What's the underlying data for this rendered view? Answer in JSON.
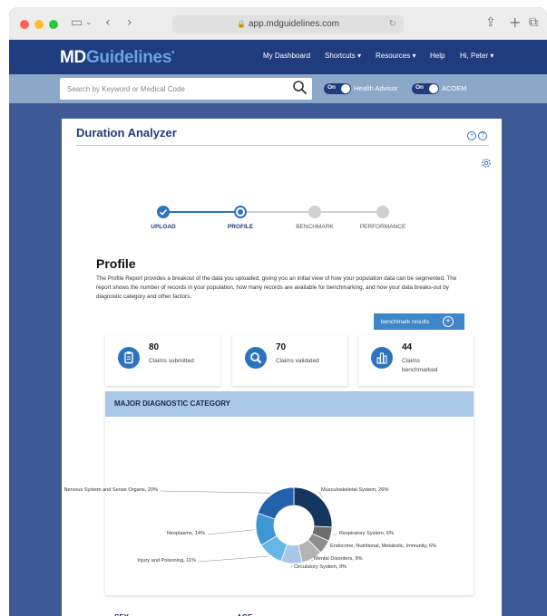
{
  "browser": {
    "url": "app.mdguidelines.com"
  },
  "header": {
    "logo_md": "MD",
    "logo_guidelines": "Guidelines",
    "logo_mark": "•",
    "nav": [
      "My Dashboard",
      "Shortcuts ▾",
      "Resources ▾",
      "Help",
      "Hi, Peter ▾"
    ]
  },
  "search": {
    "placeholder": "Search by Keyword or Medical Code",
    "toggle_on_label": "On",
    "toggle1_label": "Health Advisor",
    "toggle2_label": "ACOEM"
  },
  "card": {
    "title": "Duration Analyzer",
    "steps": [
      {
        "label": "UPLOAD",
        "state": "done"
      },
      {
        "label": "PROFILE",
        "state": "active"
      },
      {
        "label": "BENCHMARK",
        "state": "pending"
      },
      {
        "label": "PERFORMANCE",
        "state": "pending"
      }
    ],
    "profile_title": "Profile",
    "profile_text": "The Profile Report provides a breakout of the data you uploaded, giving you an initial view of how your population data can be segmented. The report shows the number of records in your population, how many records are available for benchmarking, and how your data breaks-out by diagnostic category and other factors.",
    "benchmark_button": "benchmark results",
    "stats": [
      {
        "value": "80",
        "label": "Claims submitted",
        "icon": "clipboard-icon"
      },
      {
        "value": "70",
        "label": "Claims validated",
        "icon": "search-icon"
      },
      {
        "value": "44",
        "label": "Claims benchmarked",
        "icon": "bar-chart-icon"
      }
    ],
    "diag_title": "MAJOR DIAGNOSTIC CATEGORY",
    "sex_title": "SEX",
    "age_title": "AGE"
  },
  "colors": {
    "accent": "#1f3c7e",
    "step_active": "#2d73bf",
    "step_pending": "#cfcfcf"
  },
  "chart_data": {
    "type": "pie",
    "donut": true,
    "title": "MAJOR DIAGNOSTIC CATEGORY",
    "slices": [
      {
        "label": "Musculoskeletal System, 26%",
        "value": 26,
        "color": "#15365e"
      },
      {
        "label": "Respiratory System, 6%",
        "value": 6,
        "color": "#6c6c6c"
      },
      {
        "label": "Endocrine, Nutritional, Metabolic, Immunity, 6%",
        "value": 6,
        "color": "#8e8e8e"
      },
      {
        "label": "Mental Disorders, 9%",
        "value": 9,
        "color": "#b4b4b4"
      },
      {
        "label": "Circulatory System, 9%",
        "value": 9,
        "color": "#a8c6ea"
      },
      {
        "label": "Injury and Poisoning, 11%",
        "value": 11,
        "color": "#67b7e6"
      },
      {
        "label": "Neoplasms, 14%",
        "value": 14,
        "color": "#3d96d6"
      },
      {
        "label": "Nervous System and Sense Organs, 20%",
        "value": 20,
        "color": "#2361ad"
      }
    ]
  }
}
